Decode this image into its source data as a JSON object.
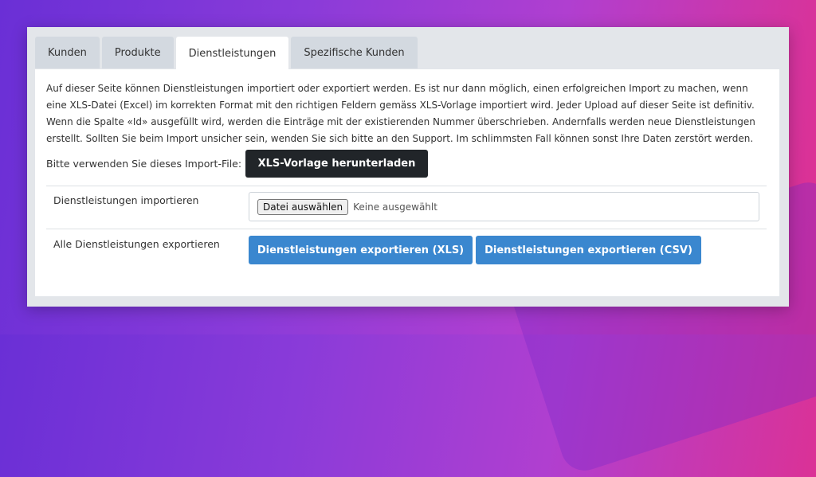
{
  "tabs": [
    {
      "label": "Kunden",
      "active": false
    },
    {
      "label": "Produkte",
      "active": false
    },
    {
      "label": "Dienstleistungen",
      "active": true
    },
    {
      "label": "Spezifische Kunden",
      "active": false
    }
  ],
  "intro_text": "Auf dieser Seite können Dienstleistungen importiert oder exportiert werden. Es ist nur dann möglich, einen erfolgreichen Import zu machen, wenn eine XLS-Datei (Excel) im korrekten Format mit den richtigen Feldern gemäss XLS-Vorlage importiert wird. Jeder Upload auf dieser Seite ist definitiv. Wenn die Spalte «Id» ausgefüllt wird, werden die Einträge mit der existierenden Nummer überschrieben. Andernfalls werden neue Dienstleistungen erstellt. Sollten Sie beim Import unsicher sein, wenden Sie sich bitte an den Support. Im schlimmsten Fall können sonst Ihre Daten zerstört werden.",
  "template_row": {
    "label": "Bitte verwenden Sie dieses Import-File:",
    "button": "XLS-Vorlage herunterladen"
  },
  "import_row": {
    "label": "Dienstleistungen importieren",
    "file_button": "Datei auswählen",
    "file_status": "Keine ausgewählt"
  },
  "export_row": {
    "label": "Alle Dienstleistungen exportieren",
    "xls_button": "Dienstleistungen exportieren (XLS)",
    "csv_button": "Dienstleistungen exportieren (CSV)"
  },
  "colors": {
    "primary": "#3a87cf",
    "dark_button": "#212529",
    "tab_inactive": "#d3d9e0"
  }
}
